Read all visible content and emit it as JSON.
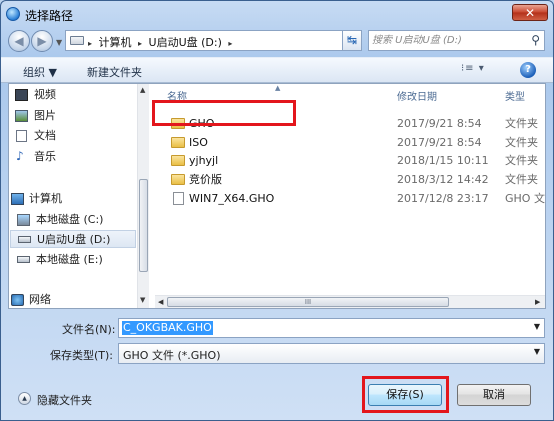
{
  "window": {
    "title": "选择路径",
    "close_symbol": "✕"
  },
  "address_bar": {
    "breadcrumbs": [
      "计算机",
      "U启动U盘 (D:)"
    ],
    "separator": "▸",
    "search_placeholder": "搜索 U启动U盘 (D:)"
  },
  "toolbar": {
    "organize": "组织 ▼",
    "new_folder": "新建文件夹",
    "view": "⁝≡ ▾",
    "help": "?"
  },
  "nav_items": [
    {
      "label": "视频",
      "icon": "video-library-icon",
      "selected": false
    },
    {
      "label": "图片",
      "icon": "pictures-library-icon",
      "selected": false
    },
    {
      "label": "文档",
      "icon": "documents-library-icon",
      "selected": false
    },
    {
      "label": "音乐",
      "icon": "music-library-icon",
      "selected": false
    },
    {
      "label": "计算机",
      "icon": "computer-icon",
      "selected": false
    },
    {
      "label": "本地磁盘 (C:)",
      "icon": "system-drive-icon",
      "selected": false
    },
    {
      "label": "U启动U盘 (D:)",
      "icon": "usb-drive-icon",
      "selected": true
    },
    {
      "label": "本地磁盘 (E:)",
      "icon": "local-drive-icon",
      "selected": false
    },
    {
      "label": "网络",
      "icon": "network-icon",
      "selected": false
    }
  ],
  "columns": {
    "name": "名称",
    "modified": "修改日期",
    "type": "类型"
  },
  "files": [
    {
      "name": "GHO",
      "date": "2017/9/21 8:54",
      "type": "文件夹",
      "kind": "folder"
    },
    {
      "name": "ISO",
      "date": "2017/9/21 8:54",
      "type": "文件夹",
      "kind": "folder"
    },
    {
      "name": "yjhyjl",
      "date": "2018/1/15 10:11",
      "type": "文件夹",
      "kind": "folder"
    },
    {
      "name": "竞价版",
      "date": "2018/3/12 14:42",
      "type": "文件夹",
      "kind": "folder"
    },
    {
      "name": "WIN7_X64.GHO",
      "date": "2017/12/8 23:17",
      "type": "GHO 文件",
      "kind": "file"
    }
  ],
  "hscroll_grip": "III",
  "form": {
    "filename_label": "文件名(N):",
    "filename_value": "C_OKGBAK.GHO",
    "filetype_label": "保存类型(T):",
    "filetype_value": "GHO 文件 (*.GHO)"
  },
  "footer": {
    "hide_folders": "隐藏文件夹",
    "save": "保存(S)",
    "cancel": "取消"
  },
  "colors": {
    "highlight_red": "#e3161c",
    "selection_blue": "#3399ff"
  }
}
